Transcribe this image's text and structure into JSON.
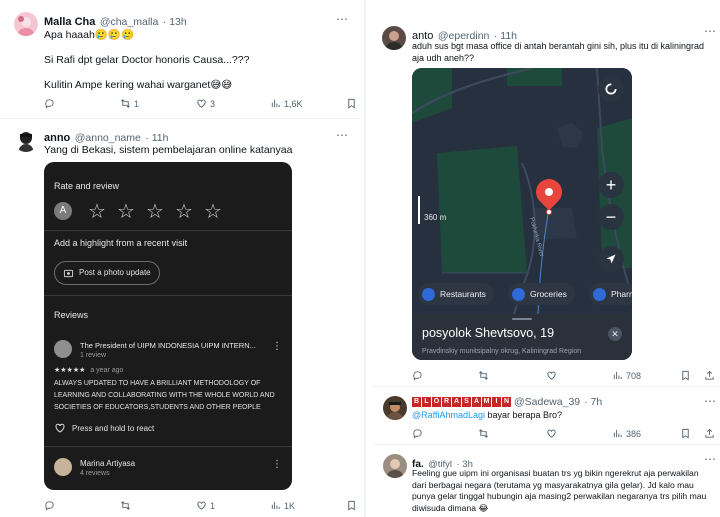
{
  "left": {
    "tweet1": {
      "name": "Malla Cha",
      "handle": "@cha_malla",
      "time": "· 13h",
      "line1": "Apa haaah",
      "line1_emoji": "🥲🥲🥲",
      "line2": "Si Rafi dpt gelar Doctor honoris Causa...???",
      "line3": "Kulitin Ampe kering wahai warganet",
      "line3_emoji": "😅😅",
      "replies": "",
      "retweets": "1",
      "likes": "3",
      "views": "1,6K"
    },
    "tweet2": {
      "name": "anno",
      "handle": "@anno_name",
      "time": "· 11h",
      "text": "Yang di Bekasi, sistem pembelajaran online katanyaa",
      "replies": "",
      "retweets": "",
      "likes": "1",
      "views": "1K",
      "card": {
        "rate_title": "Rate and review",
        "avatar_letter": "A",
        "highlight_title": "Add a highlight from a recent visit",
        "post_photo": "Post a photo update",
        "reviews_title": "Reviews",
        "review1_name": "The President of UIPM INDONESIA UIPM INTERN...",
        "review1_count": "1 review",
        "review1_stars": "★★★★★",
        "review1_time": "a year ago",
        "review1_text": "ALWAYS UPDATED TO HAVE A BRILLIANT METHODOLOGY OF LEARNING AND COLLABORATING WITH THE WHOLE WORLD AND SOCIETIES OF EDUCATORS,STUDENTS AND OTHER PEOPLE",
        "press_react": "Press and hold to react",
        "review2_name": "Marina Artiyasa",
        "review2_count": "4 reviews"
      }
    }
  },
  "right": {
    "tweet1": {
      "name": "anto",
      "handle": "@eperdinn",
      "time": "· 11h",
      "text": "aduh sus bgt masa office di antah berantah gini sih, plus itu di kaliningrad aja udh aneh??",
      "replies": "",
      "retweets": "",
      "likes": "",
      "views": "708",
      "map": {
        "scale": "360 m",
        "river": "Pokhinka River",
        "chips": [
          "Restaurants",
          "Groceries",
          "Pharm"
        ],
        "place": "posyolok Shevtsovo, 19",
        "region": "Pravdinskiy munitsipalny okrug, Kaliningrad Region"
      }
    },
    "tweet2": {
      "name_letters": [
        "B",
        "L",
        "O",
        "R",
        "A",
        "S",
        "A",
        "M",
        "I",
        "N"
      ],
      "handle": "@Sadewa_39",
      "time": "· 7h",
      "mention": "@RaffiAhmadLagi",
      "text": " bayar berapa Bro?",
      "views": "386"
    },
    "tweet3": {
      "name": "fa.",
      "handle": "@tifyl",
      "time": "· 3h",
      "text": "Feeling gue uipm ini organisasi buatan trs yg bikin ngerekrut aja perwakilan dari berbagai negara (terutama yg masyarakatnya gila gelar). Jd kalo mau punya gelar tinggal hubungin aja masing2 perwakilan negaranya trs pilih mau diwisuda dimana",
      "emoji": "😂"
    }
  },
  "colors": {
    "accent": "#1d9bf0",
    "text": "#0f1419",
    "muted": "#536471",
    "card_bg": "#1b1b1c",
    "map_pin": "#e8453c"
  }
}
